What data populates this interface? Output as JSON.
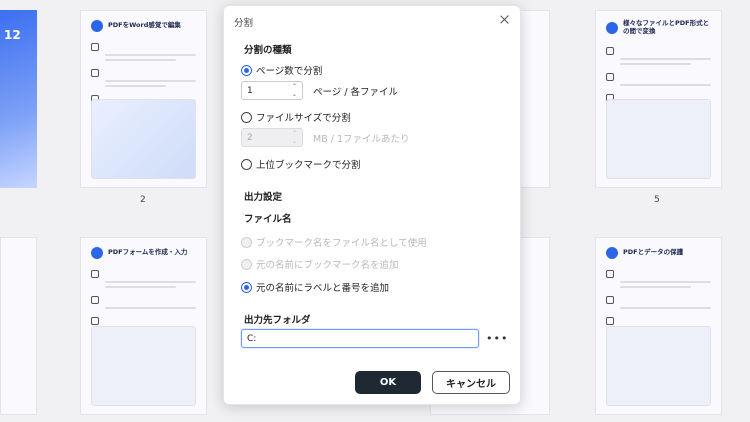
{
  "background": {
    "thumbnails": [
      {
        "title": "PDFをWord感覚で編集",
        "page_label": "2"
      },
      {
        "title": "様々なファイルとPDF形式との間で変換",
        "page_label": "5"
      },
      {
        "title": "PDFフォームを作成・入力",
        "page_label": ""
      },
      {
        "title": "PDFとデータの保護",
        "page_label": ""
      }
    ],
    "hero_text": "12"
  },
  "dialog": {
    "title": "分割",
    "split_method": {
      "heading": "分割の種類",
      "options": [
        {
          "label": "ページ数で分割",
          "checked": true,
          "enabled": true
        },
        {
          "label": "ファイルサイズで分割",
          "checked": false,
          "enabled": true
        },
        {
          "label": "上位ブックマークで分割",
          "checked": false,
          "enabled": true
        }
      ],
      "pages_value": "1",
      "pages_unit": "ページ / 各ファイル",
      "size_value": "2",
      "size_unit": "MB / 1ファイルあたり"
    },
    "output_settings": {
      "heading": "出力設定",
      "filename_heading": "ファイル名",
      "filename_options": [
        {
          "label": "ブックマーク名をファイル名として使用",
          "checked": false,
          "enabled": false
        },
        {
          "label": "元の名前にブックマーク名を追加",
          "checked": false,
          "enabled": false
        },
        {
          "label": "元の名前にラベルと番号を追加",
          "checked": true,
          "enabled": true
        }
      ],
      "folder_heading": "出力先フォルダ",
      "folder_value": "C:",
      "browse_label": "•••"
    },
    "ok_label": "OK",
    "cancel_label": "キャンセル"
  }
}
